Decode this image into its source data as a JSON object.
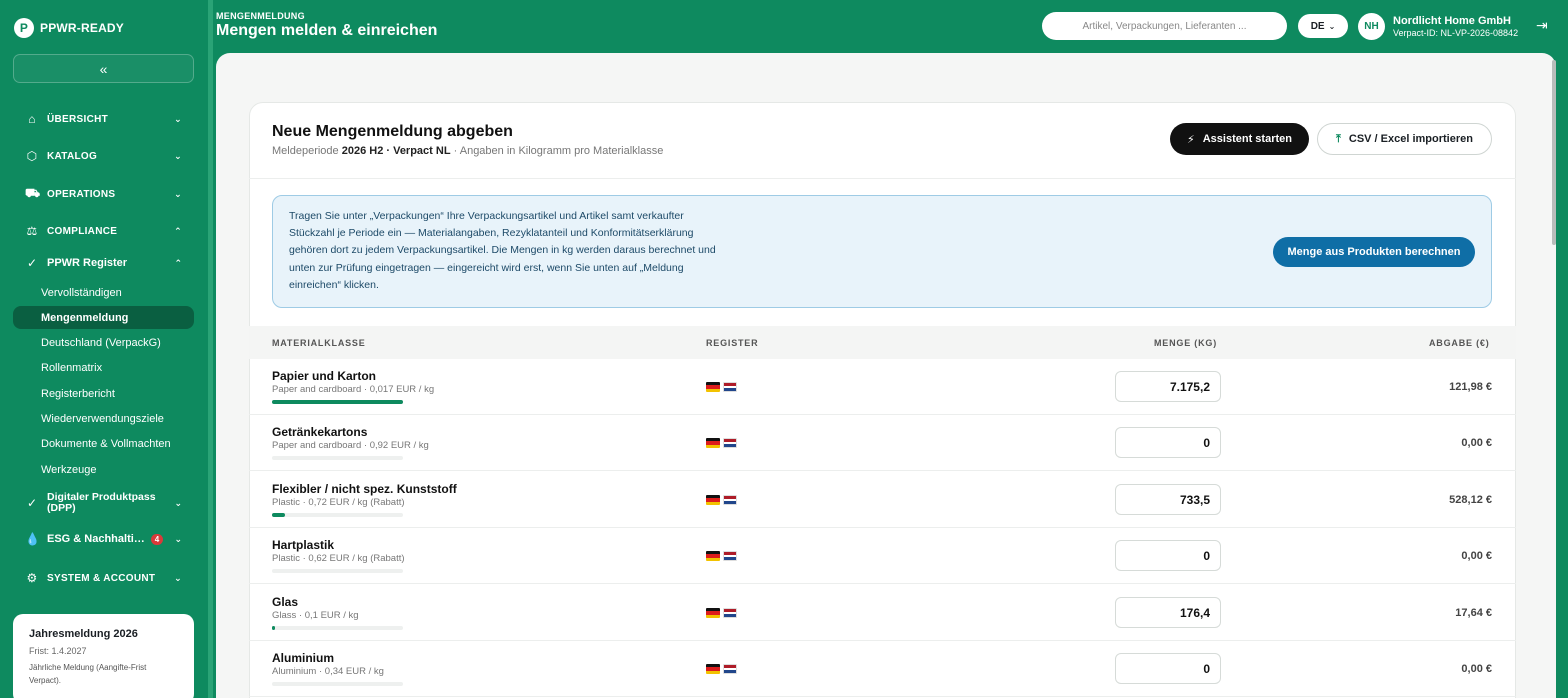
{
  "app": {
    "brand": "PPWR-READY",
    "logo_letter": "P"
  },
  "sidebar": {
    "collapse_label": "«",
    "sections": [
      {
        "label": "ÜBERSICHT",
        "icon": "home-icon",
        "glyph": "⌂",
        "chevron": "⌄"
      },
      {
        "label": "KATALOG",
        "icon": "box-icon",
        "glyph": "⬡",
        "chevron": "⌄"
      },
      {
        "label": "OPERATIONS",
        "icon": "truck-icon",
        "glyph": "⛟",
        "chevron": "⌄"
      },
      {
        "label": "COMPLIANCE",
        "icon": "scale-icon",
        "glyph": "⚖",
        "chevron": "⌃"
      }
    ],
    "ppwr": {
      "label": "PPWR Register",
      "icon": "check-circle-icon",
      "glyph": "✓",
      "chevron": "⌃"
    },
    "sub_items": [
      "Vervollständigen",
      "Mengenmeldung",
      "Deutschland (VerpackG)",
      "Rollenmatrix",
      "Registerbericht",
      "Wiederverwendungsziele",
      "Dokumente & Vollmachten",
      "Werkzeuge"
    ],
    "active_sub": "Mengenmeldung",
    "dpp": {
      "label": "Digitaler Produktpass (DPP)",
      "glyph": "✓",
      "chevron": "⌄"
    },
    "esg": {
      "label": "ESG & Nachhalti…",
      "badge": "4",
      "glyph": "💧",
      "chevron": "⌄"
    },
    "system": {
      "label": "SYSTEM & ACCOUNT",
      "glyph": "⚙",
      "chevron": "⌄"
    },
    "year_card": {
      "title": "Jahresmeldung 2026",
      "deadline": "Frist: 1.4.2027",
      "desc": "Jährliche Meldung (Aangifte-Frist Verpact)."
    }
  },
  "topbar": {
    "subtitle": "MENGENMELDUNG",
    "title": "Mengen melden & einreichen",
    "search_placeholder": "Artikel, Verpackungen, Lieferanten ...",
    "lang": "DE",
    "avatar": "NH",
    "user_name": "Nordlicht Home GmbH",
    "user_id": "Verpact-ID: NL-VP-2026-08842"
  },
  "card": {
    "title": "Neue Mengenmeldung abgeben",
    "period_prefix": "Meldeperiode",
    "period_bold": "2026 H2 · Verpact NL",
    "period_suffix": "· Angaben in Kilogramm pro Materialklasse",
    "btn_assistant": "Assistent starten",
    "btn_import": "CSV / Excel importieren",
    "info_text": "Tragen Sie unter „Verpackungen“ Ihre Verpackungsartikel und Artikel samt verkaufter Stückzahl je Periode ein — Materialangaben, Rezyklatanteil und Konformitätserklärung gehören dort zu jedem Verpackungsartikel. Die Mengen in kg werden daraus berechnet und unten zur Prüfung eingetragen — eingereicht wird erst, wenn Sie unten auf „Meldung einreichen“ klicken.",
    "btn_calc": "Menge aus Produkten berechnen"
  },
  "table": {
    "headers": {
      "material": "MATERIALKLASSE",
      "register": "REGISTER",
      "qty": "MENGE (KG)",
      "fee": "ABGABE (€)"
    },
    "rows": [
      {
        "name": "Papier und Karton",
        "meta": "Paper and cardboard · 0,017 EUR / kg",
        "share": 1.0,
        "qty": "7.175,2",
        "fee": "121,98 €"
      },
      {
        "name": "Getränkekartons",
        "meta": "Paper and cardboard · 0,92 EUR / kg",
        "share": 0.0,
        "qty": "0",
        "fee": "0,00 €"
      },
      {
        "name": "Flexibler / nicht spez. Kunststoff",
        "meta": "Plastic · 0,72 EUR / kg (Rabatt)",
        "share": 0.1,
        "qty": "733,5",
        "fee": "528,12 €"
      },
      {
        "name": "Hartplastik",
        "meta": "Plastic · 0,62 EUR / kg (Rabatt)",
        "share": 0.0,
        "qty": "0",
        "fee": "0,00 €"
      },
      {
        "name": "Glas",
        "meta": "Glass · 0,1 EUR / kg",
        "share": 0.025,
        "qty": "176,4",
        "fee": "17,64 €"
      },
      {
        "name": "Aluminium",
        "meta": "Aluminium · 0,34 EUR / kg",
        "share": 0.0,
        "qty": "0",
        "fee": "0,00 €"
      }
    ],
    "flag_de": [
      "#111111",
      "#dd1c1c",
      "#f2c200"
    ],
    "flag_nl": [
      "#ae1c28",
      "#ffffff",
      "#21468b"
    ]
  },
  "colors": {
    "brand": "#0e8a5f",
    "info_bg": "#e8f3fa",
    "blue": "#0f6ea6"
  }
}
